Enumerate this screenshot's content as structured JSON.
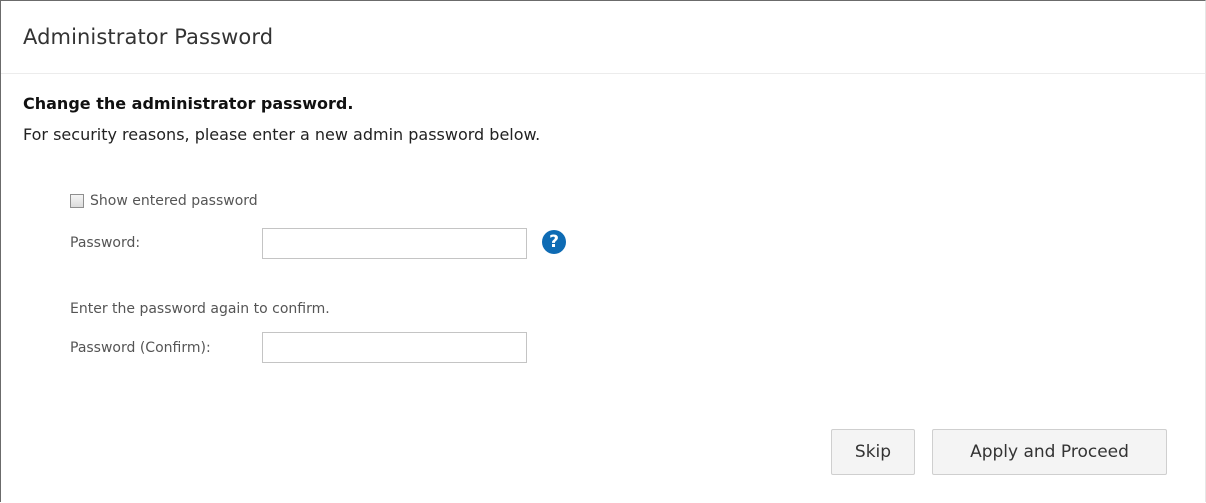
{
  "dialog": {
    "title": "Administrator Password",
    "heading": "Change the administrator password.",
    "description": "For security reasons, please enter a new admin password below."
  },
  "form": {
    "show_password_label": "Show entered password",
    "password_label": "Password:",
    "confirm_hint": "Enter the password again to confirm.",
    "confirm_label": "Password (Confirm):",
    "password_value": "",
    "confirm_value": "",
    "help_icon": "help-circle-icon"
  },
  "buttons": {
    "skip_label": "Skip",
    "apply_label": "Apply and Proceed"
  },
  "colors": {
    "help_icon": "#0e6bb4",
    "button_bg": "#f4f4f4"
  }
}
